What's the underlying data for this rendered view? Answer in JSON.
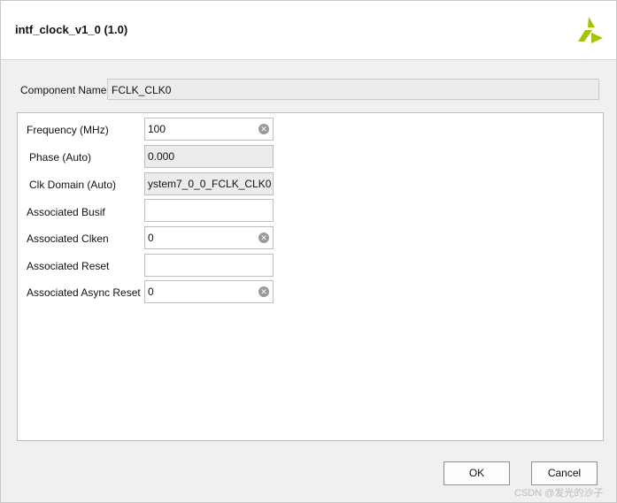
{
  "dialog": {
    "title": "intf_clock_v1_0 (1.0)",
    "logo_icon": "xilinx-logo-icon",
    "accent_color": "#a4c400"
  },
  "component": {
    "label": "Component Name",
    "value": "FCLK_CLK0"
  },
  "params": {
    "frequency": {
      "label": "Frequency (MHz)",
      "value": "100"
    },
    "phase": {
      "label": "Phase (Auto)",
      "value": "0.000"
    },
    "clk_domain": {
      "label": "Clk Domain (Auto)",
      "value": "ystem7_0_0_FCLK_CLK0"
    },
    "busif": {
      "label": "Associated Busif",
      "value": ""
    },
    "clken": {
      "label": "Associated Clken",
      "value": "0"
    },
    "reset": {
      "label": "Associated Reset",
      "value": ""
    },
    "async_reset": {
      "label": "Associated Async Reset",
      "value": "0"
    }
  },
  "buttons": {
    "ok": "OK",
    "cancel": "Cancel"
  },
  "watermark": "CSDN @发光的沙子"
}
